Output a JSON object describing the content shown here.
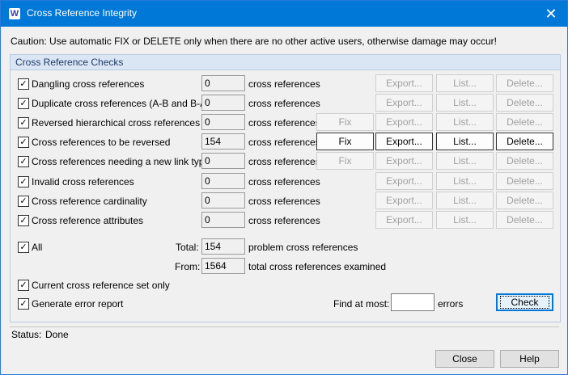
{
  "window": {
    "title": "Cross Reference Integrity",
    "app_icon_letter": "W",
    "close_glyph": "✕"
  },
  "caution_text": "Caution: Use automatic FIX or DELETE only when there are no other active users, otherwise damage may occur!",
  "group": {
    "title": "Cross Reference Checks",
    "rows": [
      {
        "label": "Dangling cross references",
        "checked": true,
        "count": "0",
        "unit": "cross references",
        "fix": null,
        "fix_enabled": false,
        "export": "Export...",
        "list": "List...",
        "delete": "Delete...",
        "actions_enabled": false
      },
      {
        "label": "Duplicate cross references (A-B and B-A)",
        "checked": true,
        "count": "0",
        "unit": "cross references",
        "fix": null,
        "fix_enabled": false,
        "export": "Export...",
        "list": "List...",
        "delete": "Delete...",
        "actions_enabled": false
      },
      {
        "label": "Reversed hierarchical cross references",
        "checked": true,
        "count": "0",
        "unit": "cross references",
        "fix": "Fix",
        "fix_enabled": false,
        "export": "Export...",
        "list": "List...",
        "delete": "Delete...",
        "actions_enabled": false
      },
      {
        "label": "Cross references to be reversed",
        "checked": true,
        "count": "154",
        "unit": "cross references",
        "fix": "Fix",
        "fix_enabled": true,
        "export": "Export...",
        "list": "List...",
        "delete": "Delete...",
        "actions_enabled": true
      },
      {
        "label": "Cross references needing a new link type",
        "checked": true,
        "count": "0",
        "unit": "cross references",
        "fix": "Fix",
        "fix_enabled": false,
        "export": "Export...",
        "list": "List...",
        "delete": "Delete...",
        "actions_enabled": false
      },
      {
        "label": "Invalid cross references",
        "checked": true,
        "count": "0",
        "unit": "cross references",
        "fix": null,
        "fix_enabled": false,
        "export": "Export...",
        "list": "List...",
        "delete": "Delete...",
        "actions_enabled": false
      },
      {
        "label": "Cross reference cardinality",
        "checked": true,
        "count": "0",
        "unit": "cross references",
        "fix": null,
        "fix_enabled": false,
        "export": "Export...",
        "list": "List...",
        "delete": "Delete...",
        "actions_enabled": false
      },
      {
        "label": "Cross reference attributes",
        "checked": true,
        "count": "0",
        "unit": "cross references",
        "fix": null,
        "fix_enabled": false,
        "export": "Export...",
        "list": "List...",
        "delete": "Delete...",
        "actions_enabled": false
      }
    ],
    "all": {
      "label": "All",
      "checked": true
    },
    "total": {
      "label": "Total:",
      "value": "154",
      "unit": "problem cross references"
    },
    "from": {
      "label": "From:",
      "value": "1564",
      "unit": "total cross references examined"
    },
    "current_set": {
      "label": "Current cross reference set only",
      "checked": true
    },
    "generate_report": {
      "label": "Generate error report",
      "checked": true
    },
    "find_at_most": {
      "label": "Find at most:",
      "value": "",
      "unit": "errors"
    },
    "check_button": "Check"
  },
  "status": {
    "label": "Status:",
    "value": "Done"
  },
  "footer": {
    "close_button": "Close",
    "help_button": "Help"
  },
  "colors": {
    "titlebar": "#0078d7",
    "group_header": "#dbe6f4",
    "background": "#f0f0f0"
  },
  "checkbox_glyph": "✓"
}
